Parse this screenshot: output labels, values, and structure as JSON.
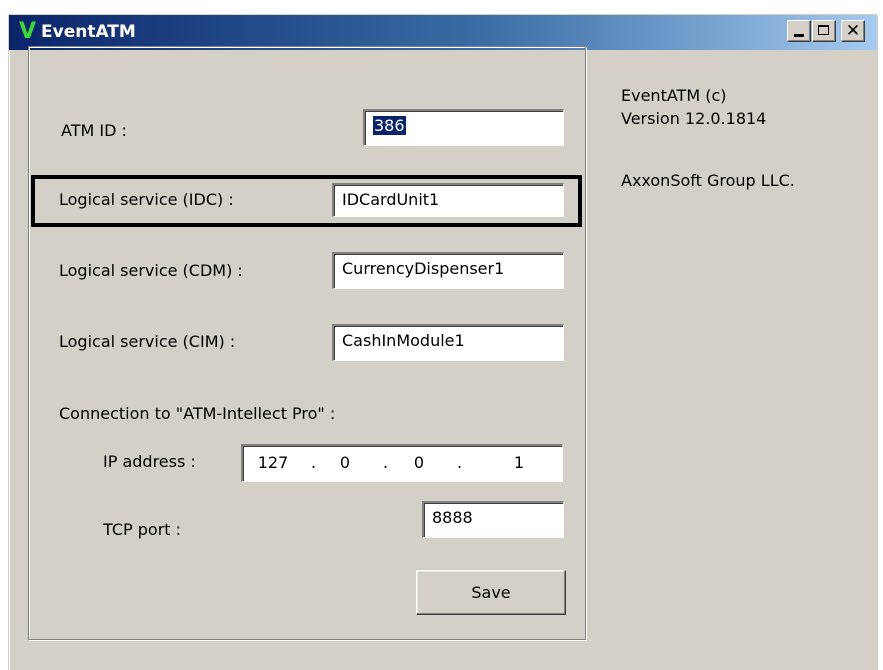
{
  "window": {
    "title": "EventATM",
    "logo_glyph": "V",
    "logo_color": "#3ad83a",
    "titlebar_color": "#0a246a",
    "buttons": {
      "minimize": "minimize-icon",
      "maximize": "maximize-icon",
      "close_glyph": "✕"
    }
  },
  "form": {
    "atm_id": {
      "label": "ATM ID :",
      "value": "386"
    },
    "idc": {
      "label": "Logical service (IDC) :",
      "value": "IDCardUnit1"
    },
    "cdm": {
      "label": "Logical service (CDM) :",
      "value": "CurrencyDispenser1"
    },
    "cim": {
      "label": "Logical service (CIM) :",
      "value": "CashInModule1"
    },
    "connection_label": "Connection to \"ATM-Intellect Pro\" :",
    "ip": {
      "label": "IP address :",
      "parts": [
        "127",
        "0",
        "0",
        "1"
      ]
    },
    "tcp": {
      "label": "TCP port :",
      "value": "8888"
    },
    "save_label": "Save"
  },
  "info": {
    "line1": "EventATM (c)",
    "line2": "Version 12.0.1814",
    "company": "AxxonSoft Group LLC."
  }
}
